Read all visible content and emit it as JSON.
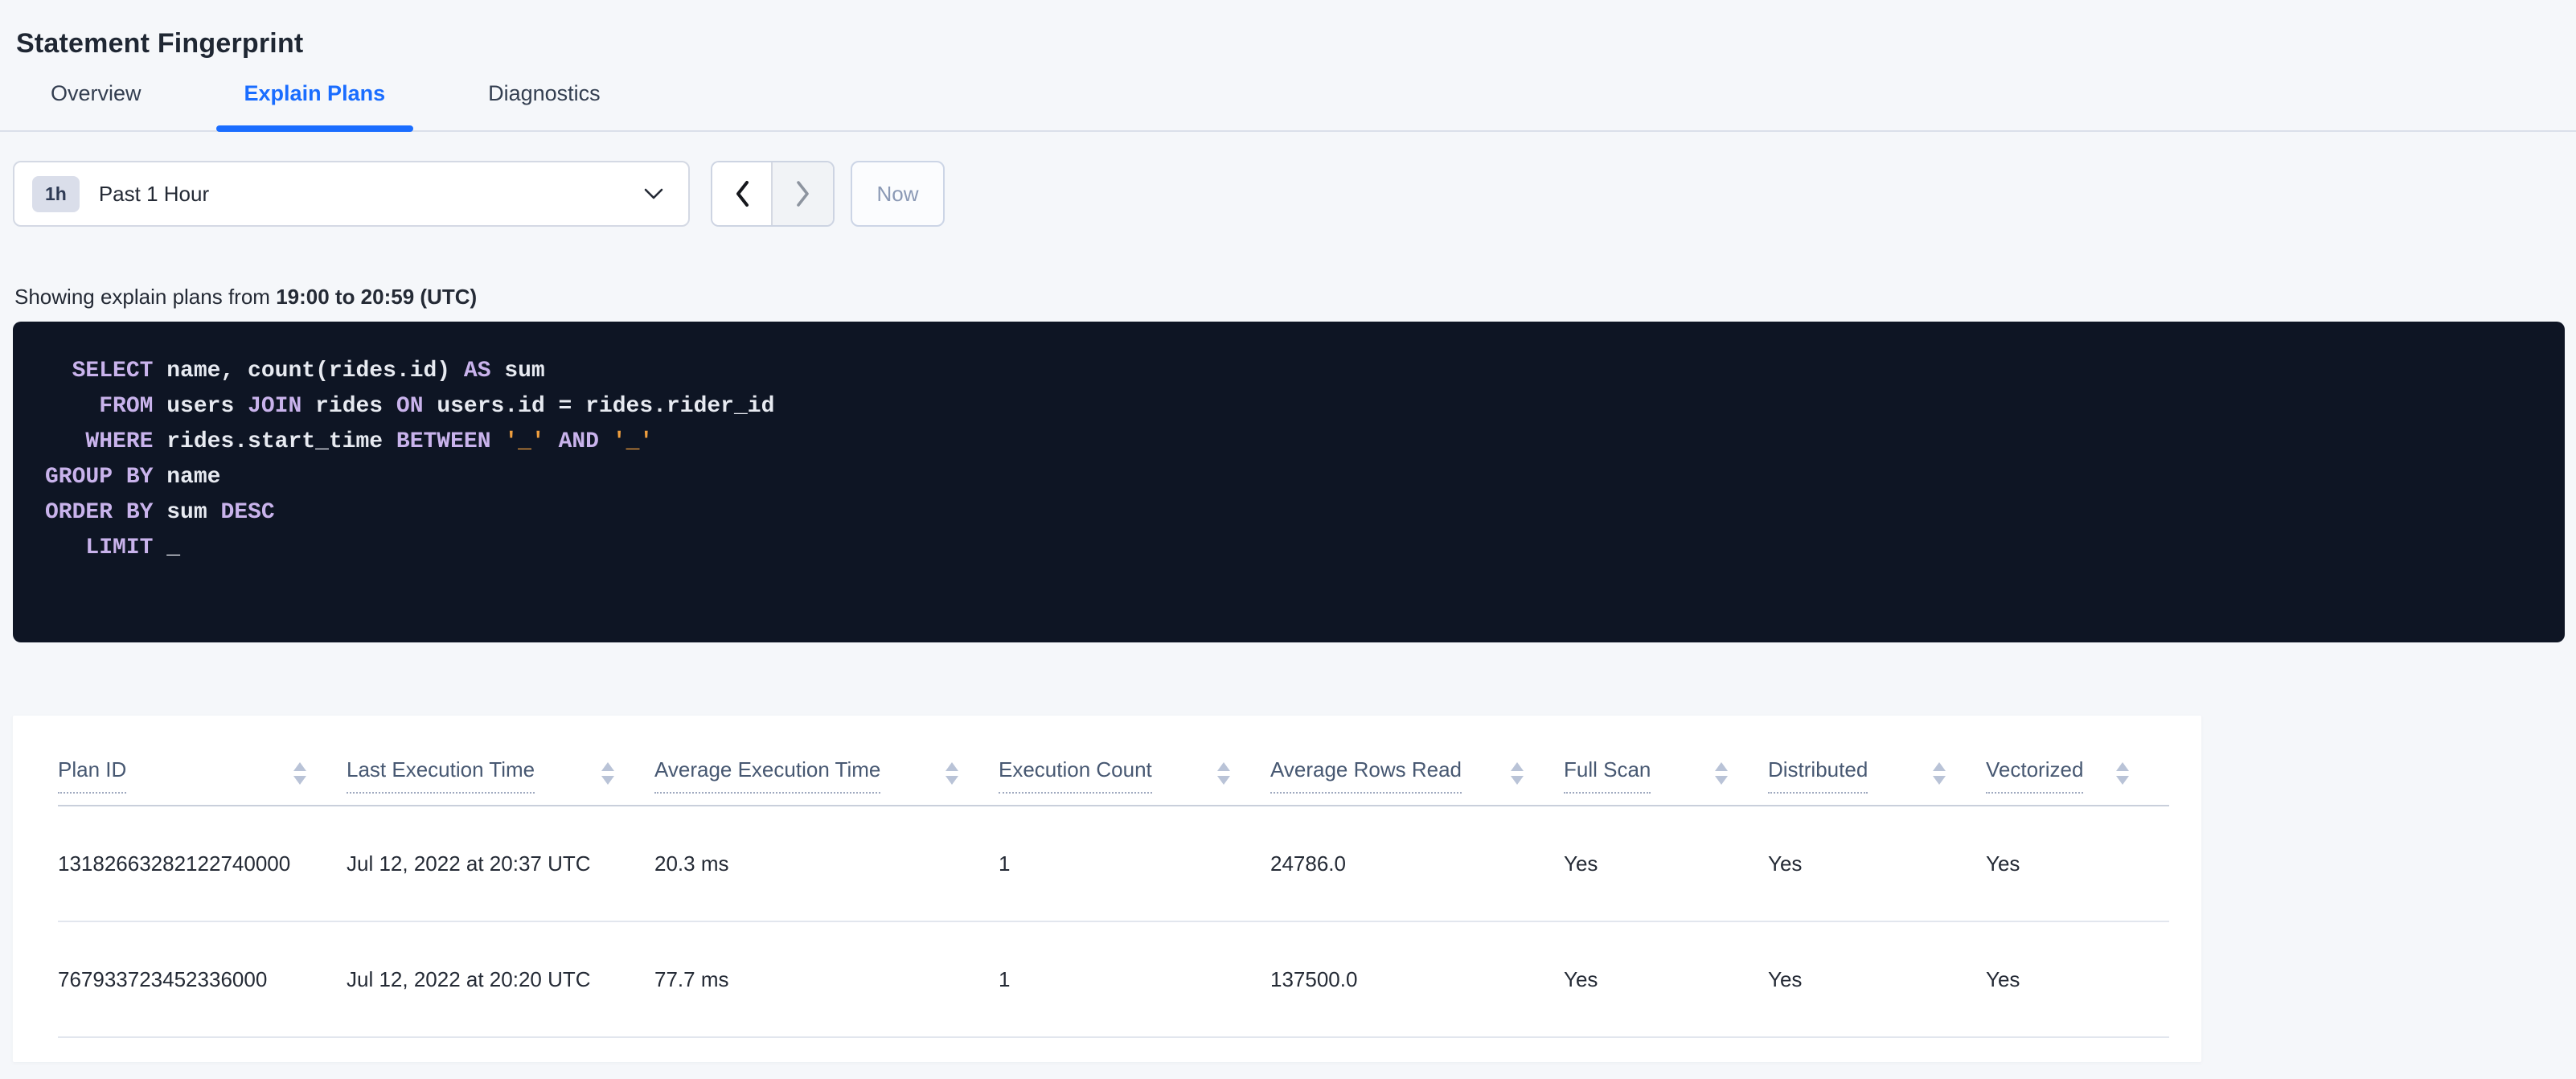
{
  "page": {
    "title": "Statement Fingerprint"
  },
  "tabs": [
    {
      "label": "Overview",
      "active": false
    },
    {
      "label": "Explain Plans",
      "active": true
    },
    {
      "label": "Diagnostics",
      "active": false
    }
  ],
  "time_picker": {
    "badge": "1h",
    "label": "Past 1 Hour",
    "now_label": "Now",
    "dropdown_icon": "chevron-down-icon",
    "prev_icon": "chevron-left-icon",
    "next_icon": "chevron-right-icon"
  },
  "status_line": {
    "prefix": "Showing explain plans from ",
    "range_bold": "19:00 to 20:59 (UTC)"
  },
  "sql": {
    "lines": [
      [
        {
          "t": "  ",
          "c": "id"
        },
        {
          "t": "SELECT",
          "c": "kw"
        },
        {
          "t": " name, count(rides.id) ",
          "c": "id"
        },
        {
          "t": "AS",
          "c": "kw"
        },
        {
          "t": " sum",
          "c": "id"
        }
      ],
      [
        {
          "t": "    ",
          "c": "id"
        },
        {
          "t": "FROM",
          "c": "kw"
        },
        {
          "t": " users ",
          "c": "id"
        },
        {
          "t": "JOIN",
          "c": "kw"
        },
        {
          "t": " rides ",
          "c": "id"
        },
        {
          "t": "ON",
          "c": "kw"
        },
        {
          "t": " users.id = rides.rider_id",
          "c": "id"
        }
      ],
      [
        {
          "t": "   ",
          "c": "id"
        },
        {
          "t": "WHERE",
          "c": "kw"
        },
        {
          "t": " rides.start_time ",
          "c": "id"
        },
        {
          "t": "BETWEEN",
          "c": "kw"
        },
        {
          "t": " ",
          "c": "id"
        },
        {
          "t": "'_'",
          "c": "str"
        },
        {
          "t": " ",
          "c": "id"
        },
        {
          "t": "AND",
          "c": "kw"
        },
        {
          "t": " ",
          "c": "id"
        },
        {
          "t": "'_'",
          "c": "str"
        }
      ],
      [
        {
          "t": "GROUP BY",
          "c": "kw"
        },
        {
          "t": " name",
          "c": "id"
        }
      ],
      [
        {
          "t": "ORDER BY",
          "c": "kw"
        },
        {
          "t": " sum ",
          "c": "id"
        },
        {
          "t": "DESC",
          "c": "kw"
        }
      ],
      [
        {
          "t": "   ",
          "c": "id"
        },
        {
          "t": "LIMIT",
          "c": "kw"
        },
        {
          "t": " _",
          "c": "id"
        }
      ]
    ]
  },
  "table": {
    "columns": [
      {
        "label": "Plan ID",
        "sortable": true
      },
      {
        "label": "Last Execution Time",
        "sortable": true
      },
      {
        "label": "Average Execution Time",
        "sortable": true
      },
      {
        "label": "Execution Count",
        "sortable": true
      },
      {
        "label": "Average Rows Read",
        "sortable": true
      },
      {
        "label": "Full Scan",
        "sortable": true
      },
      {
        "label": "Distributed",
        "sortable": true
      },
      {
        "label": "Vectorized",
        "sortable": true
      }
    ],
    "rows": [
      {
        "cells": [
          "13182663282122740000",
          "Jul 12, 2022 at 20:37 UTC",
          "20.3 ms",
          "1",
          "24786.0",
          "Yes",
          "Yes",
          "Yes"
        ]
      },
      {
        "cells": [
          "767933723452336000",
          "Jul 12, 2022 at 20:20 UTC",
          "77.7 ms",
          "1",
          "137500.0",
          "Yes",
          "Yes",
          "Yes"
        ]
      }
    ]
  },
  "colors": {
    "page_bg": "#f5f7fa",
    "accent_blue": "#1a6dff",
    "code_bg": "#0e1524",
    "sql_keyword": "#c9b3ec",
    "sql_identifier": "#e7eaf1",
    "sql_string": "#ef9e3e",
    "header_text": "#475872",
    "body_text": "#242a35"
  }
}
